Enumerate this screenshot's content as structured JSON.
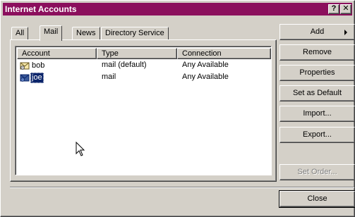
{
  "window": {
    "title": "Internet Accounts",
    "help_glyph": "?",
    "close_glyph": "✕"
  },
  "tabs": [
    {
      "label": "All"
    },
    {
      "label": "Mail",
      "active": true
    },
    {
      "label": "News"
    },
    {
      "label": "Directory Service"
    }
  ],
  "list": {
    "columns": [
      "Account",
      "Type",
      "Connection"
    ],
    "rows": [
      {
        "account": "bob",
        "type": "mail (default)",
        "connection": "Any Available",
        "selected": false
      },
      {
        "account": "joe",
        "type": "mail",
        "connection": "Any Available",
        "selected": true
      }
    ]
  },
  "buttons": {
    "add": "Add",
    "remove": "Remove",
    "properties": "Properties",
    "set_default": "Set as Default",
    "import": "Import...",
    "export": "Export...",
    "set_order": "Set Order...",
    "close": "Close"
  },
  "colors": {
    "titlebar": "#8b0f5d",
    "selection": "#0a246a",
    "face": "#d4d0c8"
  },
  "icons": {
    "account": "mail-account-icon",
    "add_arrow": "arrow-right-icon",
    "cursor": "mouse-pointer-icon"
  }
}
